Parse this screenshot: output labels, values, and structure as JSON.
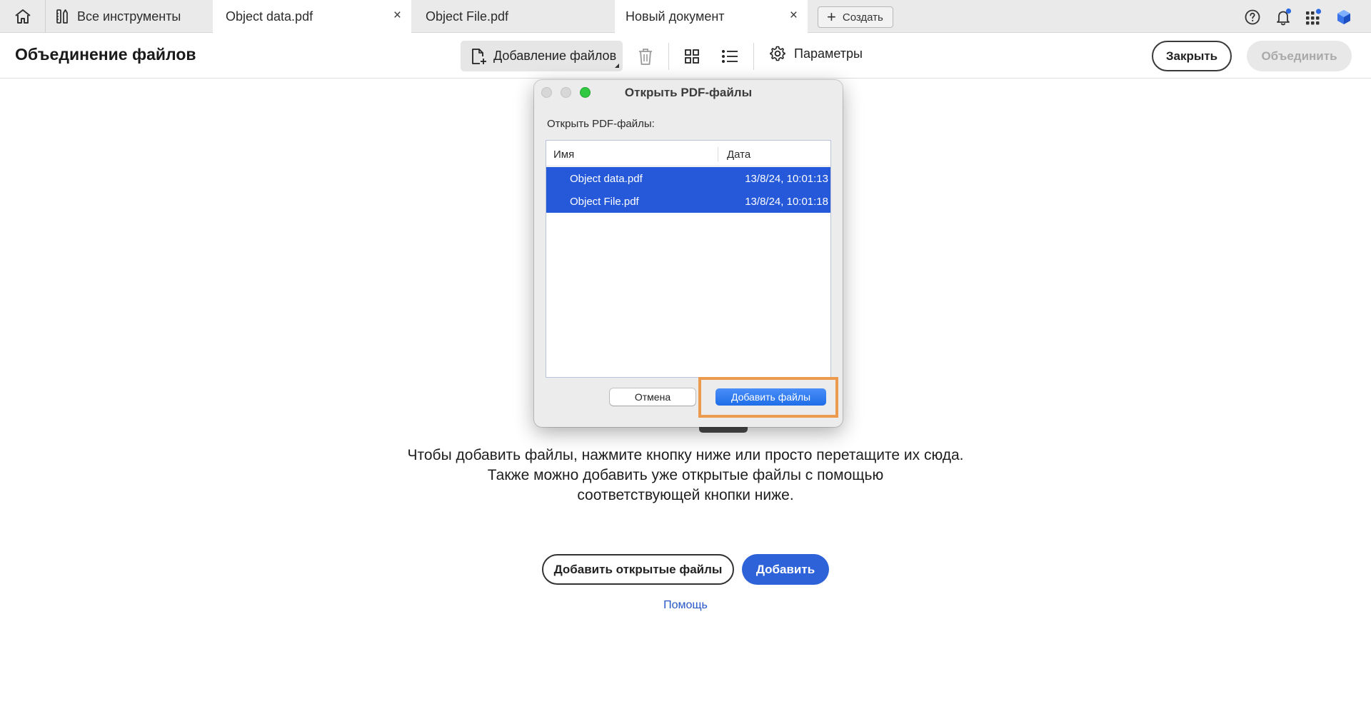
{
  "tabs": {
    "home_icon": "home-icon",
    "tools_label": "Все инструменты",
    "items": [
      {
        "label": "Object data.pdf",
        "active": true
      },
      {
        "label": "Object File.pdf",
        "active": false
      },
      {
        "label": "Новый документ",
        "active": true
      }
    ],
    "close_glyph": "×",
    "create_label": "Создать",
    "create_plus": "+"
  },
  "toolbar": {
    "title": "Объединение файлов",
    "add_files_label": "Добавление файлов",
    "params_label": "Параметры",
    "close_label": "Закрыть",
    "merge_label": "Объединить",
    "accent": "#2d62d8"
  },
  "main": {
    "hint_lines": [
      "Чтобы добавить файлы, нажмите кнопку ниже или просто перетащите их сюда.",
      "Также можно добавить уже открытые файлы с помощью",
      "соответствующей кнопки ниже."
    ],
    "add_open_label": "Добавить открытые файлы",
    "add_label": "Добавить",
    "help_label": "Помощь"
  },
  "dialog": {
    "title": "Открыть PDF-файлы",
    "label": "Открыть PDF-файлы:",
    "col_name": "Имя",
    "col_date": "Дата",
    "files": [
      {
        "name": "Object data.pdf",
        "date": "13/8/24, 10:01:13"
      },
      {
        "name": "Object File.pdf",
        "date": "13/8/24, 10:01:18"
      }
    ],
    "cancel_label": "Отмена",
    "add_files_label": "Добавить файлы",
    "selection_color": "#2559d9",
    "highlight_color": "#ec9b4e"
  }
}
